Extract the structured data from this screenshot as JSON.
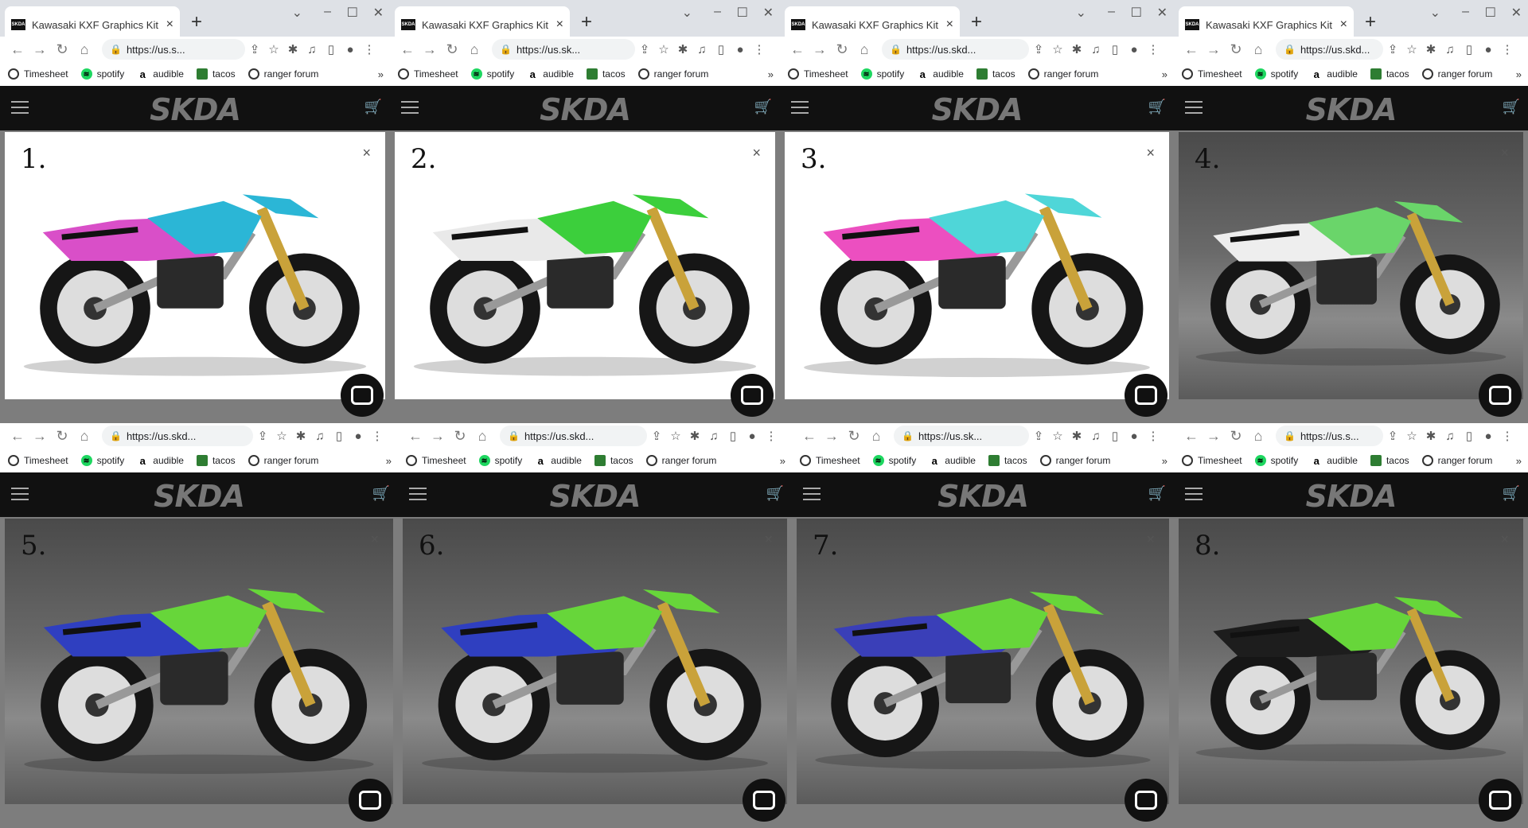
{
  "bookmarks": [
    {
      "label": "Timesheet",
      "icon": "clock-icon"
    },
    {
      "label": "spotify",
      "icon": "spotify-icon"
    },
    {
      "label": "audible",
      "icon": "amazon-icon"
    },
    {
      "label": "tacos",
      "icon": "image-icon"
    },
    {
      "label": "ranger forum",
      "icon": "globe-icon"
    }
  ],
  "site": {
    "logo": "SKDA"
  },
  "windows": [
    {
      "tab_title": "Kawasaki KXF Graphics Kit - b",
      "url": "https://us.s...",
      "number": "1.",
      "bg": "white",
      "accent": "#d94fc8",
      "accent2": "#2bb6d6"
    },
    {
      "tab_title": "Kawasaki KXF Graphics Kit - b",
      "url": "https://us.sk...",
      "number": "2.",
      "bg": "white",
      "accent": "#e9e9e9",
      "accent2": "#3ccf3c"
    },
    {
      "tab_title": "Kawasaki KXF Graphics Kit - by S",
      "url": "https://us.skd...",
      "number": "3.",
      "bg": "white",
      "accent": "#ec4fc0",
      "accent2": "#4fd6d8"
    },
    {
      "tab_title": "Kawasaki KXF Graphics Kit - by",
      "url": "https://us.skd...",
      "number": "4.",
      "bg": "studio",
      "accent": "#eeeeee",
      "accent2": "#6ad56a"
    },
    {
      "tab_title": "",
      "url": "https://us.skd...",
      "number": "5.",
      "bg": "studio",
      "accent": "#2f3fc0",
      "accent2": "#67d63a"
    },
    {
      "tab_title": "",
      "url": "https://us.skd...",
      "number": "6.",
      "bg": "studio",
      "accent": "#2f3fc0",
      "accent2": "#67d63a"
    },
    {
      "tab_title": "",
      "url": "https://us.sk...",
      "number": "7.",
      "bg": "studio",
      "accent": "#3a3fb8",
      "accent2": "#67d63a"
    },
    {
      "tab_title": "",
      "url": "https://us.s...",
      "number": "8.",
      "bg": "studio",
      "accent": "#1d1d1d",
      "accent2": "#67d63a"
    }
  ]
}
